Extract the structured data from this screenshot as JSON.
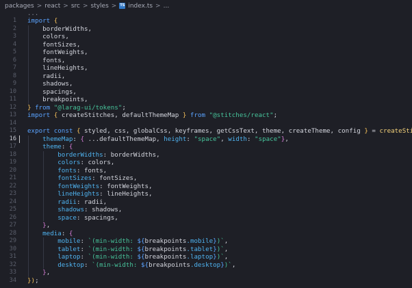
{
  "breadcrumb": {
    "items": [
      "packages",
      "react",
      "src",
      "styles"
    ],
    "file_icon_label": "TS",
    "file_name": "index.ts",
    "trailing": "...",
    "separator": ">"
  },
  "folded_marker": "...",
  "active_line": 16,
  "lines": [
    {
      "n": "1",
      "tokens": [
        {
          "t": "import ",
          "c": "kw"
        },
        {
          "t": "{",
          "c": "br"
        }
      ]
    },
    {
      "n": "2",
      "tokens": [
        {
          "t": "    borderWidths,",
          "c": "plain"
        }
      ]
    },
    {
      "n": "3",
      "tokens": [
        {
          "t": "    colors,",
          "c": "plain"
        }
      ]
    },
    {
      "n": "4",
      "tokens": [
        {
          "t": "    fontSizes,",
          "c": "plain"
        }
      ]
    },
    {
      "n": "5",
      "tokens": [
        {
          "t": "    fontWeights,",
          "c": "plain"
        }
      ]
    },
    {
      "n": "6",
      "tokens": [
        {
          "t": "    fonts,",
          "c": "plain"
        }
      ]
    },
    {
      "n": "7",
      "tokens": [
        {
          "t": "    lineHeights,",
          "c": "plain"
        }
      ]
    },
    {
      "n": "8",
      "tokens": [
        {
          "t": "    radii,",
          "c": "plain"
        }
      ]
    },
    {
      "n": "9",
      "tokens": [
        {
          "t": "    shadows,",
          "c": "plain"
        }
      ]
    },
    {
      "n": "10",
      "tokens": [
        {
          "t": "    spacings,",
          "c": "plain"
        }
      ]
    },
    {
      "n": "11",
      "tokens": [
        {
          "t": "    breakpoints,",
          "c": "plain"
        }
      ]
    },
    {
      "n": "12",
      "tokens": [
        {
          "t": "}",
          "c": "br"
        },
        {
          "t": " from ",
          "c": "kw"
        },
        {
          "t": "\"@larag-ui/tokens\"",
          "c": "str"
        },
        {
          "t": ";",
          "c": "plain"
        }
      ]
    },
    {
      "n": "13",
      "tokens": [
        {
          "t": "import ",
          "c": "kw"
        },
        {
          "t": "{",
          "c": "br"
        },
        {
          "t": " createStitches, defaultThemeMap ",
          "c": "plain"
        },
        {
          "t": "}",
          "c": "br"
        },
        {
          "t": " from ",
          "c": "kw"
        },
        {
          "t": "\"@stitches/react\"",
          "c": "str"
        },
        {
          "t": ";",
          "c": "plain"
        }
      ]
    },
    {
      "n": "14",
      "tokens": []
    },
    {
      "n": "15",
      "tokens": [
        {
          "t": "export ",
          "c": "kw"
        },
        {
          "t": "const ",
          "c": "kw"
        },
        {
          "t": "{",
          "c": "br"
        },
        {
          "t": " styled, css, globalCss, keyframes, getCssText, theme, createTheme, config ",
          "c": "plain"
        },
        {
          "t": "}",
          "c": "br"
        },
        {
          "t": " = ",
          "c": "plain"
        },
        {
          "t": "createStitches",
          "c": "fn"
        },
        {
          "t": "({",
          "c": "br"
        }
      ]
    },
    {
      "n": "16",
      "tokens": [
        {
          "t": "    ",
          "c": "plain"
        },
        {
          "t": "themeMap",
          "c": "prop"
        },
        {
          "t": ": ",
          "c": "plain"
        },
        {
          "t": "{",
          "c": "br2"
        },
        {
          "t": " ...defaultThemeMap, ",
          "c": "plain"
        },
        {
          "t": "height",
          "c": "prop"
        },
        {
          "t": ": ",
          "c": "plain"
        },
        {
          "t": "\"space\"",
          "c": "str"
        },
        {
          "t": ", ",
          "c": "plain"
        },
        {
          "t": "width",
          "c": "prop"
        },
        {
          "t": ": ",
          "c": "plain"
        },
        {
          "t": "\"space\"",
          "c": "str"
        },
        {
          "t": "}",
          "c": "br2"
        },
        {
          "t": ",",
          "c": "plain"
        }
      ]
    },
    {
      "n": "17",
      "tokens": [
        {
          "t": "    ",
          "c": "plain"
        },
        {
          "t": "theme",
          "c": "prop"
        },
        {
          "t": ": ",
          "c": "plain"
        },
        {
          "t": "{",
          "c": "br2"
        }
      ]
    },
    {
      "n": "18",
      "tokens": [
        {
          "t": "        ",
          "c": "plain"
        },
        {
          "t": "borderWidths",
          "c": "prop"
        },
        {
          "t": ": borderWidths,",
          "c": "plain"
        }
      ]
    },
    {
      "n": "19",
      "tokens": [
        {
          "t": "        ",
          "c": "plain"
        },
        {
          "t": "colors",
          "c": "prop"
        },
        {
          "t": ": colors,",
          "c": "plain"
        }
      ]
    },
    {
      "n": "20",
      "tokens": [
        {
          "t": "        ",
          "c": "plain"
        },
        {
          "t": "fonts",
          "c": "prop"
        },
        {
          "t": ": fonts,",
          "c": "plain"
        }
      ]
    },
    {
      "n": "21",
      "tokens": [
        {
          "t": "        ",
          "c": "plain"
        },
        {
          "t": "fontSizes",
          "c": "prop"
        },
        {
          "t": ": fontSizes,",
          "c": "plain"
        }
      ]
    },
    {
      "n": "22",
      "tokens": [
        {
          "t": "        ",
          "c": "plain"
        },
        {
          "t": "fontWeights",
          "c": "prop"
        },
        {
          "t": ": fontWeights,",
          "c": "plain"
        }
      ]
    },
    {
      "n": "23",
      "tokens": [
        {
          "t": "        ",
          "c": "plain"
        },
        {
          "t": "lineHeights",
          "c": "prop"
        },
        {
          "t": ": lineHeights,",
          "c": "plain"
        }
      ]
    },
    {
      "n": "24",
      "tokens": [
        {
          "t": "        ",
          "c": "plain"
        },
        {
          "t": "radii",
          "c": "prop"
        },
        {
          "t": ": radii,",
          "c": "plain"
        }
      ]
    },
    {
      "n": "25",
      "tokens": [
        {
          "t": "        ",
          "c": "plain"
        },
        {
          "t": "shadows",
          "c": "prop"
        },
        {
          "t": ": shadows,",
          "c": "plain"
        }
      ]
    },
    {
      "n": "26",
      "tokens": [
        {
          "t": "        ",
          "c": "plain"
        },
        {
          "t": "space",
          "c": "prop"
        },
        {
          "t": ": spacings,",
          "c": "plain"
        }
      ]
    },
    {
      "n": "27",
      "tokens": [
        {
          "t": "    ",
          "c": "plain"
        },
        {
          "t": "}",
          "c": "br2"
        },
        {
          "t": ",",
          "c": "plain"
        }
      ]
    },
    {
      "n": "28",
      "tokens": [
        {
          "t": "    ",
          "c": "plain"
        },
        {
          "t": "media",
          "c": "prop"
        },
        {
          "t": ": ",
          "c": "plain"
        },
        {
          "t": "{",
          "c": "br2"
        }
      ]
    },
    {
      "n": "29",
      "tokens": [
        {
          "t": "        ",
          "c": "plain"
        },
        {
          "t": "mobile",
          "c": "prop"
        },
        {
          "t": ": ",
          "c": "plain"
        },
        {
          "t": "`(min-width: ",
          "c": "str"
        },
        {
          "t": "${",
          "c": "kw"
        },
        {
          "t": "breakpoints",
          "c": "plain"
        },
        {
          "t": ".mobile",
          "c": "prop"
        },
        {
          "t": "}",
          "c": "kw"
        },
        {
          "t": ")`",
          "c": "str"
        },
        {
          "t": ",",
          "c": "plain"
        }
      ]
    },
    {
      "n": "30",
      "tokens": [
        {
          "t": "        ",
          "c": "plain"
        },
        {
          "t": "tablet",
          "c": "prop"
        },
        {
          "t": ": ",
          "c": "plain"
        },
        {
          "t": "`(min-width: ",
          "c": "str"
        },
        {
          "t": "${",
          "c": "kw"
        },
        {
          "t": "breakpoints",
          "c": "plain"
        },
        {
          "t": ".tablet",
          "c": "prop"
        },
        {
          "t": "}",
          "c": "kw"
        },
        {
          "t": ")`",
          "c": "str"
        },
        {
          "t": ",",
          "c": "plain"
        }
      ]
    },
    {
      "n": "31",
      "tokens": [
        {
          "t": "        ",
          "c": "plain"
        },
        {
          "t": "laptop",
          "c": "prop"
        },
        {
          "t": ": ",
          "c": "plain"
        },
        {
          "t": "`(min-width: ",
          "c": "str"
        },
        {
          "t": "${",
          "c": "kw"
        },
        {
          "t": "breakpoints",
          "c": "plain"
        },
        {
          "t": ".laptop",
          "c": "prop"
        },
        {
          "t": "}",
          "c": "kw"
        },
        {
          "t": ")`",
          "c": "str"
        },
        {
          "t": ",",
          "c": "plain"
        }
      ]
    },
    {
      "n": "32",
      "tokens": [
        {
          "t": "        ",
          "c": "plain"
        },
        {
          "t": "desktop",
          "c": "prop"
        },
        {
          "t": ": ",
          "c": "plain"
        },
        {
          "t": "`(min-width: ",
          "c": "str"
        },
        {
          "t": "${",
          "c": "kw"
        },
        {
          "t": "breakpoints",
          "c": "plain"
        },
        {
          "t": ".desktop",
          "c": "prop"
        },
        {
          "t": "}",
          "c": "kw"
        },
        {
          "t": ")`",
          "c": "str"
        },
        {
          "t": ",",
          "c": "plain"
        }
      ]
    },
    {
      "n": "33",
      "tokens": [
        {
          "t": "    ",
          "c": "plain"
        },
        {
          "t": "}",
          "c": "br2"
        },
        {
          "t": ",",
          "c": "plain"
        }
      ]
    },
    {
      "n": "34",
      "tokens": [
        {
          "t": "})",
          "c": "br"
        },
        {
          "t": ";",
          "c": "plain"
        }
      ]
    }
  ]
}
